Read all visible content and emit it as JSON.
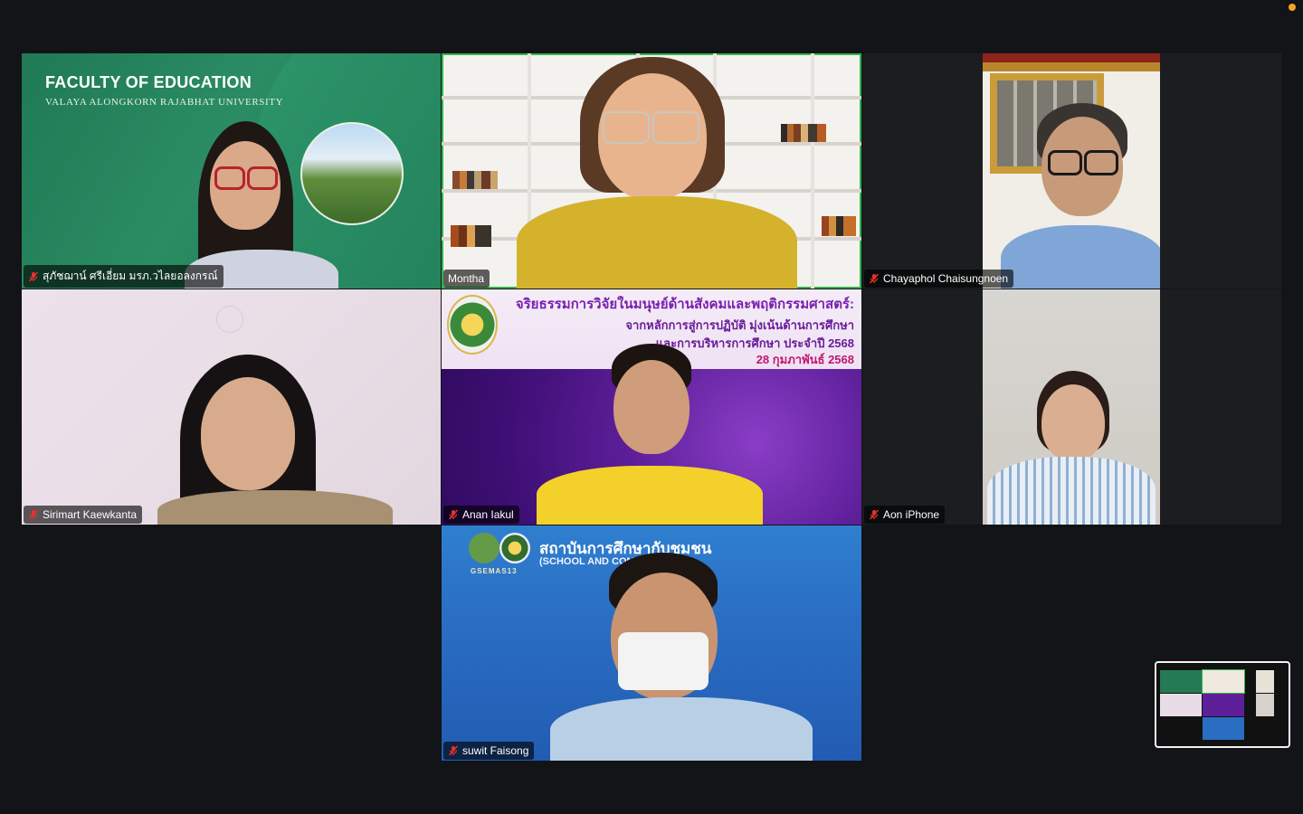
{
  "meeting": {
    "participants": [
      {
        "name": "สุภัชฌาน์ ศรีเอี่ยม มรภ.วไลยอลงกรณ์",
        "muted": true,
        "active": false
      },
      {
        "name": "Montha",
        "muted": false,
        "active": true
      },
      {
        "name": "Chayaphol Chaisungnoen",
        "muted": true,
        "active": false
      },
      {
        "name": "Sirimart Kaewkanta",
        "muted": true,
        "active": false
      },
      {
        "name": "Anan Iakul",
        "muted": true,
        "active": false
      },
      {
        "name": "Aon iPhone",
        "muted": true,
        "active": false
      },
      {
        "name": "suwit Faisong",
        "muted": true,
        "active": false
      }
    ]
  },
  "backgrounds": {
    "faculty_title": "FACULTY OF EDUCATION",
    "faculty_subtitle": "VALAYA ALONGKORN RAJABHAT UNIVERSITY",
    "banner_line1": "จริยธรรมการวิจัยในมนุษย์ด้านสังคมและพฤติกรรมศาสตร์:",
    "banner_line2": "จากหลักการสู่การปฏิบัติ มุ่งเน้นด้านการศึกษา",
    "banner_line3": "และการบริหารการศึกษา ประจำปี 2568",
    "banner_line4": "28 กุมภาพันธ์ 2568",
    "school_title": "สถาบันการศึกษากับชุมชน",
    "school_subtitle": "(SCHOOL AND COMMUNITY)",
    "school_logo_text": "GSEMAS13"
  },
  "colors": {
    "active_speaker_border": "#2fb64a",
    "muted_icon": "#e5322d",
    "background": "#121417"
  },
  "icons": {
    "mute": "microphone-muted-icon",
    "notification": "orange-status-dot"
  }
}
